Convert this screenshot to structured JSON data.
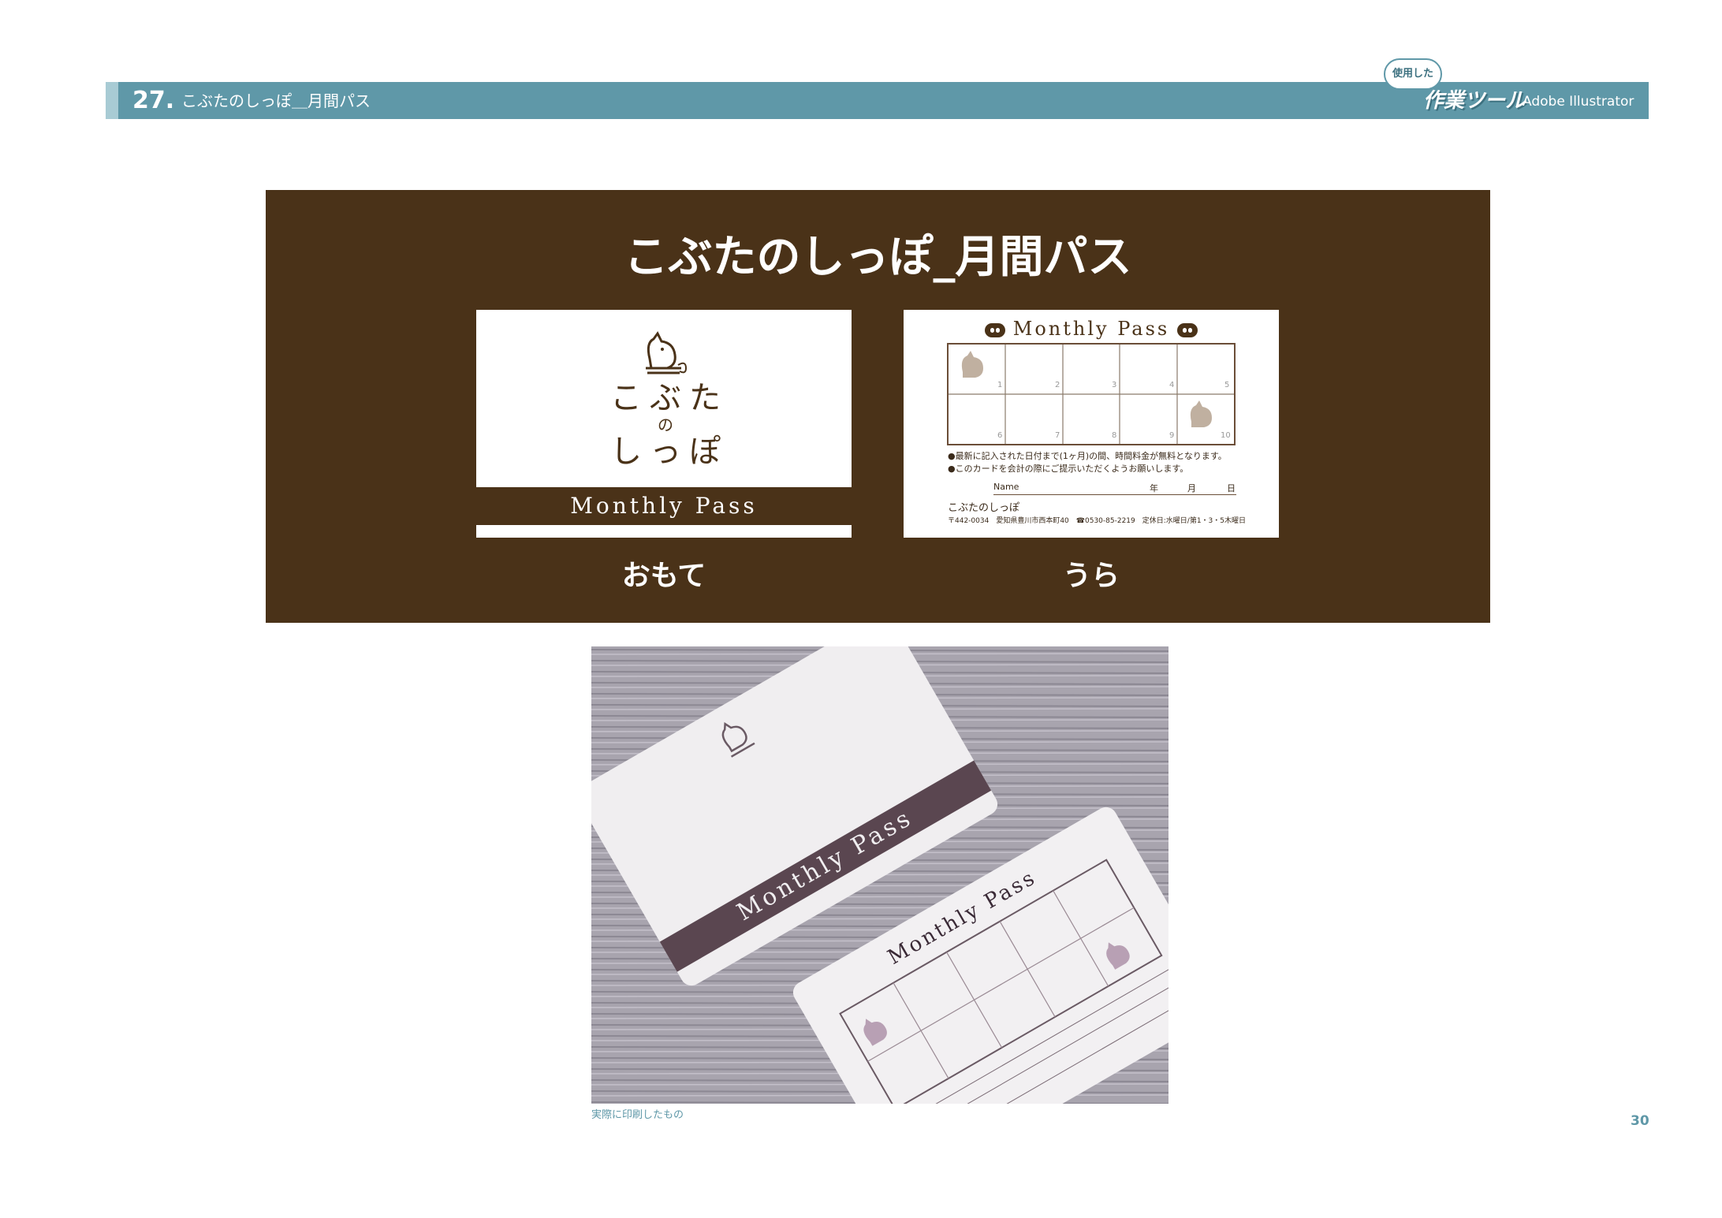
{
  "header": {
    "section_number": "27.",
    "section_title": "こぶたのしっぽ＿月間パス",
    "tool_bubble": "使用した",
    "tool_label": "作業ツール",
    "tool_name": "Adobe Illustrator"
  },
  "panel": {
    "title": "こぶたのしっぽ_月間パス",
    "front": {
      "logo_lines": [
        "こ",
        "ぶ",
        "た",
        "の",
        "し",
        "っ",
        "ぽ"
      ],
      "band_text": "Monthly Pass",
      "label": "おもて"
    },
    "back": {
      "title": "Monthly Pass",
      "slots": [
        "1",
        "2",
        "3",
        "4",
        "5",
        "6",
        "7",
        "8",
        "9",
        "10"
      ],
      "note1": "●最新に記入された日付まで(1ヶ月)の間、時間料金が無料となります。",
      "note2": "●このカードを会計の際にご提示いただくようお願いします。",
      "name_label": "Name",
      "year": "年",
      "month": "月",
      "day": "日",
      "brand": "こぶたのしっぽ",
      "address": "〒442-0034　愛知県豊川市西本町40　☎0530-85-2219　定休日:水曜日/第1・3・5木曜日",
      "label": "うら"
    }
  },
  "photo": {
    "band_text": "Monthly Pass",
    "back_title": "Monthly Pass",
    "caption": "実際に印刷したもの"
  },
  "page_number": "30",
  "colors": {
    "header": "#5f98a8",
    "panel": "#4a3218",
    "caption": "#5f98a8"
  }
}
